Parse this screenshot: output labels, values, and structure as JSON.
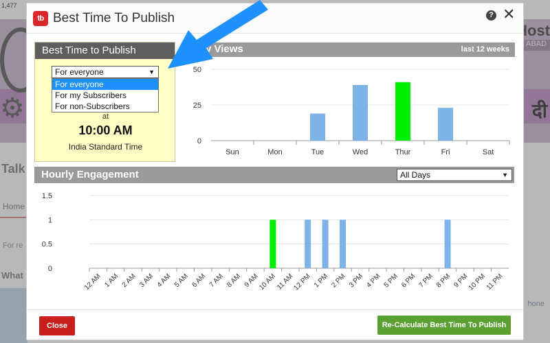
{
  "background": {
    "count": "1,477",
    "host": "Host",
    "abad": "ABAD",
    "hindi": "दी",
    "talk": "Talk",
    "home": "Home",
    "for_re": "For re",
    "what": "What",
    "phone": "hone"
  },
  "modal": {
    "title": "Best Time To Publish",
    "logo_text": "tb",
    "help_symbol": "?",
    "close_symbol": "✕"
  },
  "best_time": {
    "heading": "Best Time to Publish",
    "audience": {
      "selected": "For everyone",
      "options": [
        "For everyone",
        "For my Subscribers",
        "For non-Subscribers"
      ]
    },
    "at_label": "at",
    "time": "10:00 AM",
    "timezone": "India Standard Time"
  },
  "day_views": {
    "heading": "y Views",
    "period": "last 12 weeks"
  },
  "hourly": {
    "heading": "Hourly Engagement",
    "days_filter": "All Days"
  },
  "footer": {
    "close_label": "Close",
    "recalc_label": "Re-Calculate Best Time To Publish"
  },
  "colors": {
    "highlight": "#00ee00",
    "bar": "#7eb3e8",
    "close_red": "#c81e1e",
    "recalc_green": "#5aa132",
    "arrow_blue": "#1e90ff"
  },
  "chart_data": [
    {
      "type": "bar",
      "categories": [
        "Sun",
        "Mon",
        "Tue",
        "Wed",
        "Thur",
        "Fri",
        "Sat"
      ],
      "values": [
        0,
        0,
        19,
        39,
        41,
        23,
        0
      ],
      "highlight_index": 4,
      "ylim": [
        0,
        50
      ],
      "yticks": [
        0,
        25,
        50
      ],
      "grid": true
    },
    {
      "type": "bar",
      "categories": [
        "12 AM",
        "1 AM",
        "2 AM",
        "3 AM",
        "4 AM",
        "5 AM",
        "6 AM",
        "7 AM",
        "8 AM",
        "9 AM",
        "10 AM",
        "11 AM",
        "12 PM",
        "1 PM",
        "2 PM",
        "3 PM",
        "4 PM",
        "5 PM",
        "6 PM",
        "7 PM",
        "8 PM",
        "9 PM",
        "10 PM",
        "11 PM"
      ],
      "values": [
        0,
        0,
        0,
        0,
        0,
        0,
        0,
        0,
        0,
        0,
        1,
        0,
        1,
        1,
        1,
        0,
        0,
        0,
        0,
        0,
        1,
        0,
        0,
        0
      ],
      "highlight_index": 10,
      "ylim": [
        0,
        1.5
      ],
      "yticks": [
        0,
        0.5,
        1,
        1.5
      ],
      "grid": true
    }
  ]
}
